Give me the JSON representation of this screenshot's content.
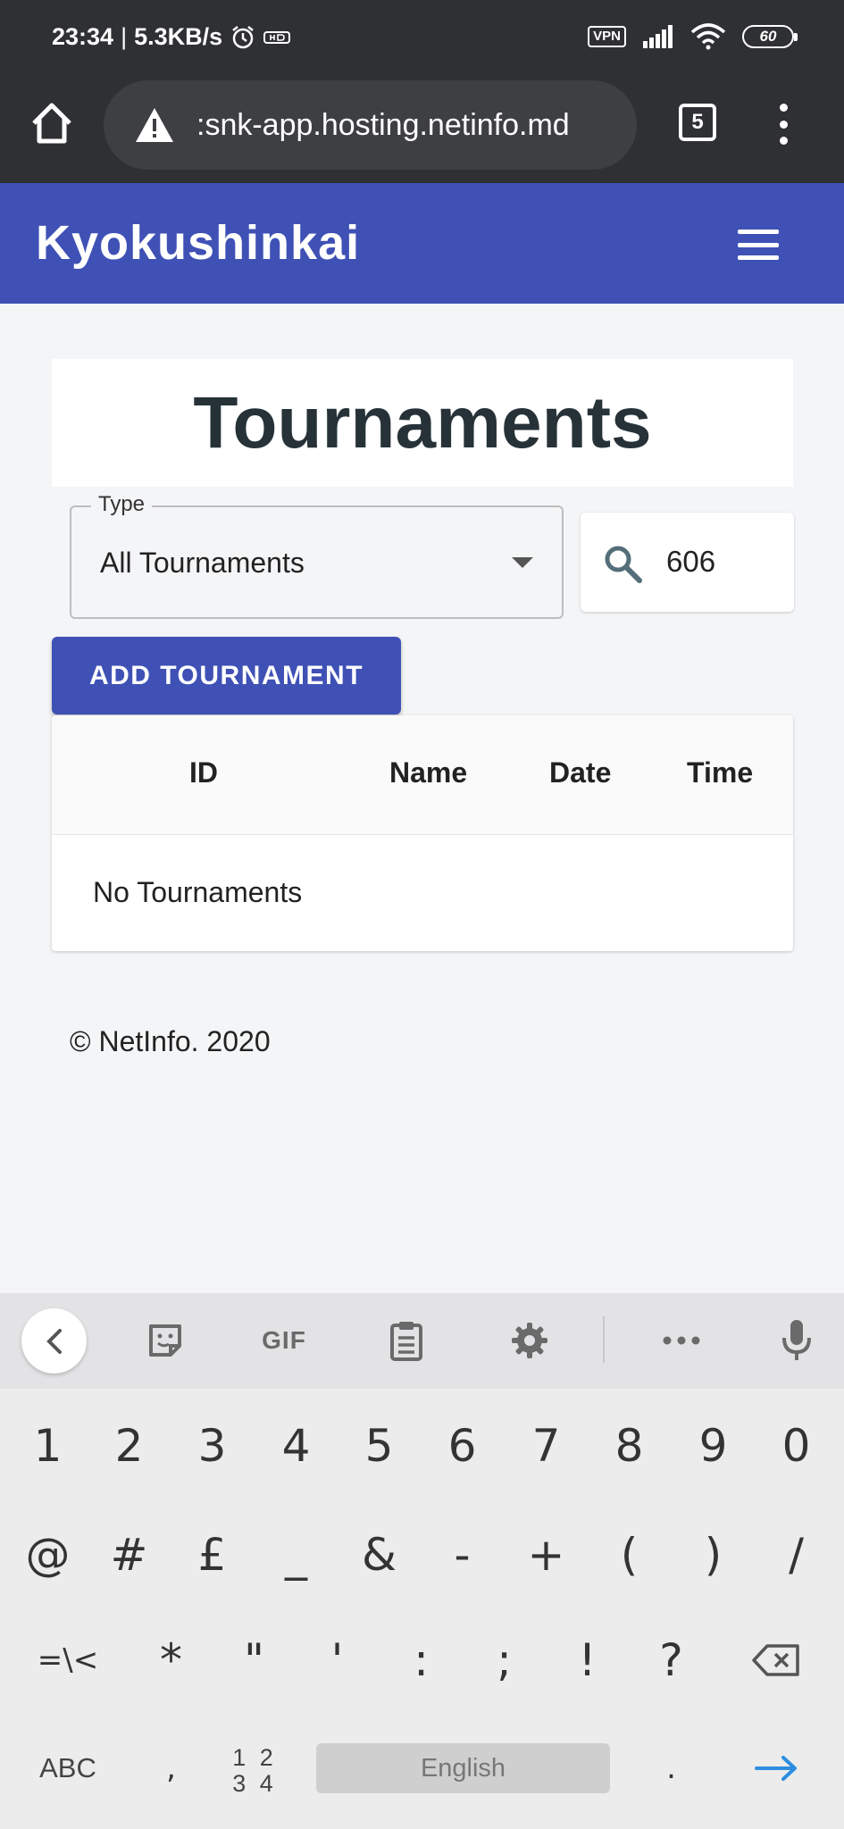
{
  "status_bar": {
    "time": "23:34",
    "net_speed": "5.3KB/s",
    "vpn_label": "VPN",
    "battery": "60"
  },
  "browser": {
    "url": ":snk-app.hosting.netinfo.md",
    "tab_count": "5"
  },
  "app": {
    "title": "Kyokushinkai"
  },
  "page": {
    "title": "Tournaments",
    "type_label": "Type",
    "type_value": "All Tournaments",
    "search_value": "606",
    "add_button": "ADD TOURNAMENT",
    "table": {
      "headers": [
        "ID",
        "Name",
        "Date",
        "Time"
      ],
      "empty_text": "No Tournaments"
    },
    "footer": "© NetInfo. 2020"
  },
  "keyboard": {
    "toolbar": {
      "gif_label": "GIF"
    },
    "row1": [
      "1",
      "2",
      "3",
      "4",
      "5",
      "6",
      "7",
      "8",
      "9",
      "0"
    ],
    "row2": [
      "@",
      "#",
      "£",
      "_",
      "&",
      "-",
      "+",
      "(",
      ")",
      "/"
    ],
    "row3": [
      "=\\<",
      "*",
      "\"",
      "'",
      ":",
      ";",
      "!",
      "?"
    ],
    "row4": {
      "abc": "ABC",
      "comma": ",",
      "num_top": "1 2",
      "num_bottom": "3 4",
      "space": "English",
      "period": "."
    }
  },
  "colors": {
    "brand": "#3f51b5",
    "chrome": "#2f3033",
    "background": "#f4f5f7",
    "enter_arrow": "#2e8ee0"
  }
}
